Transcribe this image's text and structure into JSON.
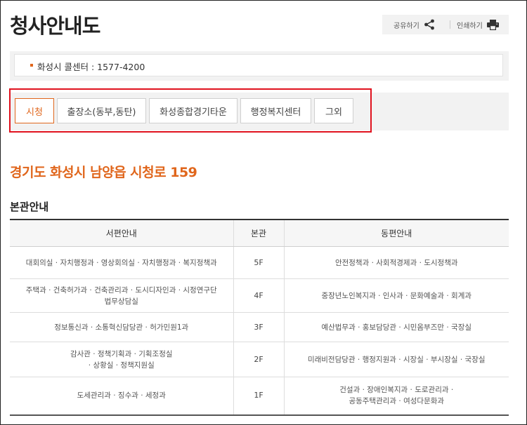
{
  "page": {
    "title": "청사안내도",
    "share_label": "공유하기",
    "print_label": "인쇄하기",
    "call_center": "화성시 콜센터 : 1577-4200",
    "address": "경기도 화성시 남양읍 시청로 159",
    "section_title": "본관안내"
  },
  "tabs": [
    {
      "label": "시청",
      "active": true
    },
    {
      "label": "출장소(동부,동탄)",
      "active": false
    },
    {
      "label": "화성종합경기타운",
      "active": false
    },
    {
      "label": "행정복지센터",
      "active": false
    },
    {
      "label": "그외",
      "active": false
    }
  ],
  "table": {
    "headers": [
      "서편안내",
      "본관",
      "동편안내"
    ],
    "rows": [
      {
        "west": [
          "대회의실 · 자치행정과 · 영상회의실 · 자치행정과 · 복지정책과"
        ],
        "floor": "5F",
        "east": [
          "안전정책과 · 사회적경제과 · 도시정책과"
        ]
      },
      {
        "west": [
          "주택과 · 건축허가과 · 건축관리과 · 도시디자인과 · 시정연구단",
          "법무상담실"
        ],
        "floor": "4F",
        "east": [
          "중장년노인복지과 · 인사과 · 문화예술과 · 회계과"
        ]
      },
      {
        "west": [
          "정보통신과 · 소통혁신담당관 · 허가민원1과"
        ],
        "floor": "3F",
        "east": [
          "예산법무과 · 홍보담당관 · 시민옴부즈만 · 국장실"
        ]
      },
      {
        "west": [
          "감사관 · 정책기획과 · 기획조정실",
          "· 상황실 · 정책지원실"
        ],
        "floor": "2F",
        "east": [
          "미래비전담당관 · 행정지원과 · 시장실 · 부시장실 · 국장실"
        ]
      },
      {
        "west": [
          "도세관리과 · 징수과 · 세정과"
        ],
        "floor": "1F",
        "east": [
          "건설과 · 장애인복지과 · 도로관리과 ·",
          "공동주택관리과 · 여성다문화과"
        ]
      }
    ]
  }
}
